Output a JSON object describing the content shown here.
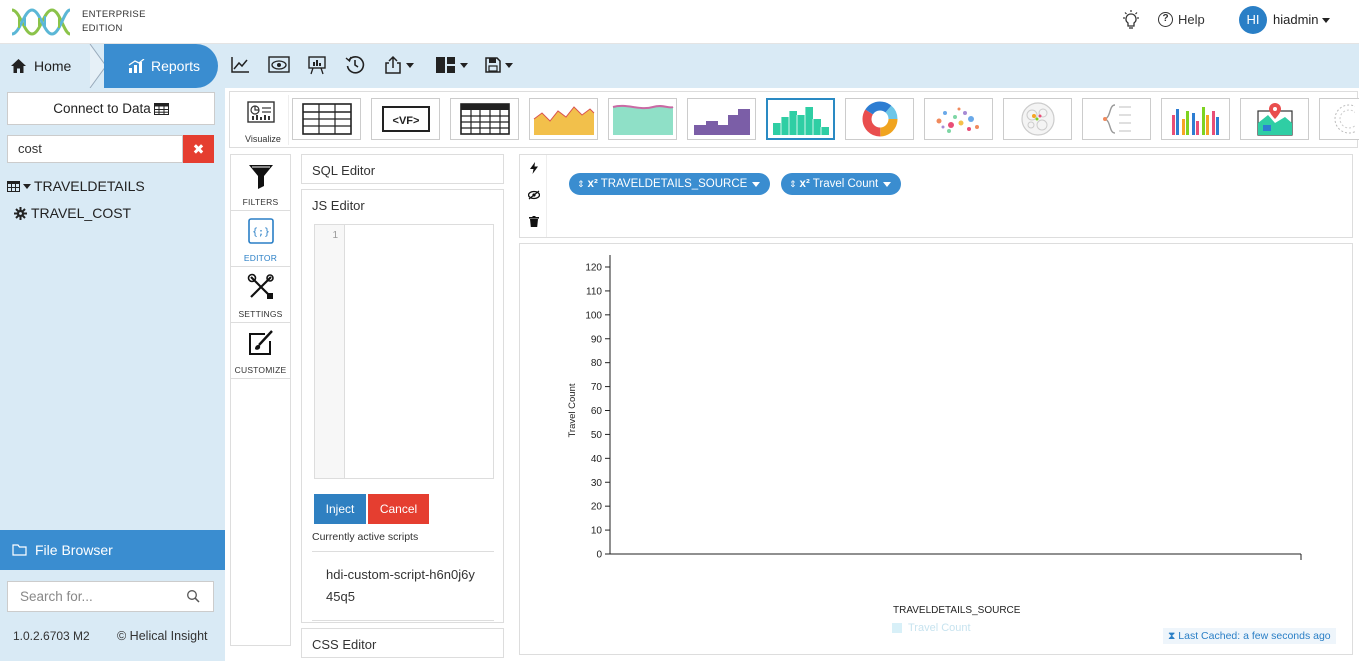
{
  "header": {
    "edition_line1": "ENTERPRISE",
    "edition_line2": "EDITION",
    "help_label": "Help",
    "avatar_initials": "HI",
    "username": "hiadmin"
  },
  "nav": {
    "home_label": "Home",
    "reports_label": "Reports",
    "toolbar_icons": [
      "chart-line-icon",
      "eye-icon",
      "presentation-icon",
      "history-icon",
      "share-icon",
      "layout-icon",
      "save-icon"
    ]
  },
  "left": {
    "connect_label": "Connect to Data",
    "search_value": "cost",
    "tree_table": "TRAVELDETAILS",
    "tree_field": "TRAVEL_COST",
    "file_browser_label": "File Browser",
    "file_search_placeholder": "Search for...",
    "version": "1.0.2.6703 M2",
    "copyright": "© Helical Insight"
  },
  "chartbar": {
    "visualize_label": "Visualize",
    "types": [
      "table-chart-icon",
      "vf-chart-icon",
      "grid-table-icon",
      "area-chart-icon",
      "stream-area-icon",
      "step-chart-icon",
      "histogram-icon",
      "donut-chart-icon",
      "scatter-chart-icon",
      "circle-pack-icon",
      "tree-chart-icon",
      "multi-bar-icon",
      "map-chart-icon",
      "radial-chart-icon"
    ],
    "selected_index": 6
  },
  "tools": {
    "filters_label": "FILTERS",
    "editor_label": "EDITOR",
    "settings_label": "SETTINGS",
    "customize_label": "CUSTOMIZE"
  },
  "editor": {
    "sql_title": "SQL Editor",
    "js_title": "JS Editor",
    "line_number": "1",
    "inject_label": "Inject",
    "cancel_label": "Cancel",
    "active_scripts_label": "Currently active scripts",
    "active_script": "hdi-custom-script-h6n0j6y45q5",
    "css_title": "CSS Editor"
  },
  "fields": {
    "x_field": "TRAVELDETAILS_SOURCE",
    "y_field": "Travel Count",
    "prefix": "x²"
  },
  "chart_data": {
    "type": "bar",
    "categories": [],
    "series": [
      {
        "name": "Travel Count",
        "values": []
      }
    ],
    "xlabel": "TRAVELDETAILS_SOURCE",
    "ylabel": "Travel Count",
    "yticks": [
      0,
      10,
      20,
      30,
      40,
      50,
      60,
      70,
      80,
      90,
      100,
      110,
      120
    ],
    "ylim": [
      0,
      120
    ],
    "legend_placement": "bottom"
  },
  "status": {
    "cached_label": "Last Cached: a few seconds ago"
  },
  "colors": {
    "accent": "#3a8dd0",
    "danger": "#e53e30",
    "panel_bg": "#d9eaf5",
    "selected_thumb": "#2a8ac3"
  }
}
